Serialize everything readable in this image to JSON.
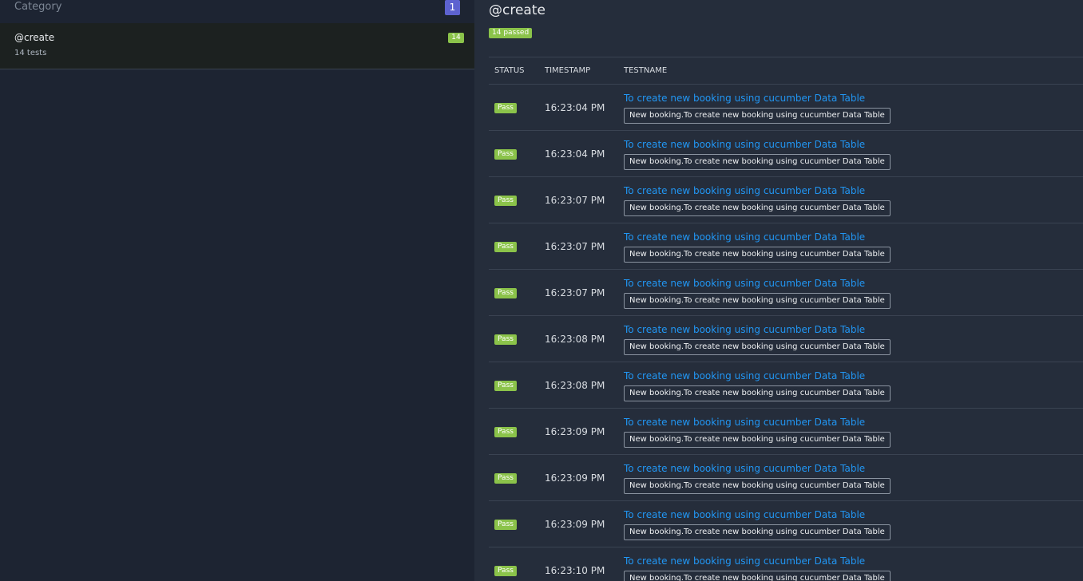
{
  "sidebar": {
    "title": "Category",
    "count": "1",
    "items": [
      {
        "name": "@create",
        "sub": "14 tests",
        "count": "14"
      }
    ]
  },
  "main": {
    "title": "@create",
    "passed": "14 passed",
    "columns": {
      "status": "STATUS",
      "timestamp": "TIMESTAMP",
      "testname": "TESTNAME"
    },
    "rows": [
      {
        "status": "Pass",
        "time": "16:23:04 PM",
        "name": "To create new booking using cucumber Data Table",
        "tag": "New booking.To create new booking using cucumber Data Table"
      },
      {
        "status": "Pass",
        "time": "16:23:04 PM",
        "name": "To create new booking using cucumber Data Table",
        "tag": "New booking.To create new booking using cucumber Data Table"
      },
      {
        "status": "Pass",
        "time": "16:23:07 PM",
        "name": "To create new booking using cucumber Data Table",
        "tag": "New booking.To create new booking using cucumber Data Table"
      },
      {
        "status": "Pass",
        "time": "16:23:07 PM",
        "name": "To create new booking using cucumber Data Table",
        "tag": "New booking.To create new booking using cucumber Data Table"
      },
      {
        "status": "Pass",
        "time": "16:23:07 PM",
        "name": "To create new booking using cucumber Data Table",
        "tag": "New booking.To create new booking using cucumber Data Table"
      },
      {
        "status": "Pass",
        "time": "16:23:08 PM",
        "name": "To create new booking using cucumber Data Table",
        "tag": "New booking.To create new booking using cucumber Data Table"
      },
      {
        "status": "Pass",
        "time": "16:23:08 PM",
        "name": "To create new booking using cucumber Data Table",
        "tag": "New booking.To create new booking using cucumber Data Table"
      },
      {
        "status": "Pass",
        "time": "16:23:09 PM",
        "name": "To create new booking using cucumber Data Table",
        "tag": "New booking.To create new booking using cucumber Data Table"
      },
      {
        "status": "Pass",
        "time": "16:23:09 PM",
        "name": "To create new booking using cucumber Data Table",
        "tag": "New booking.To create new booking using cucumber Data Table"
      },
      {
        "status": "Pass",
        "time": "16:23:09 PM",
        "name": "To create new booking using cucumber Data Table",
        "tag": "New booking.To create new booking using cucumber Data Table"
      },
      {
        "status": "Pass",
        "time": "16:23:10 PM",
        "name": "To create new booking using cucumber Data Table",
        "tag": "New booking.To create new booking using cucumber Data Table"
      }
    ]
  },
  "colors": {
    "pass": "#8bc34a",
    "link": "#2196f3",
    "count_badge": "#5d62d0"
  }
}
